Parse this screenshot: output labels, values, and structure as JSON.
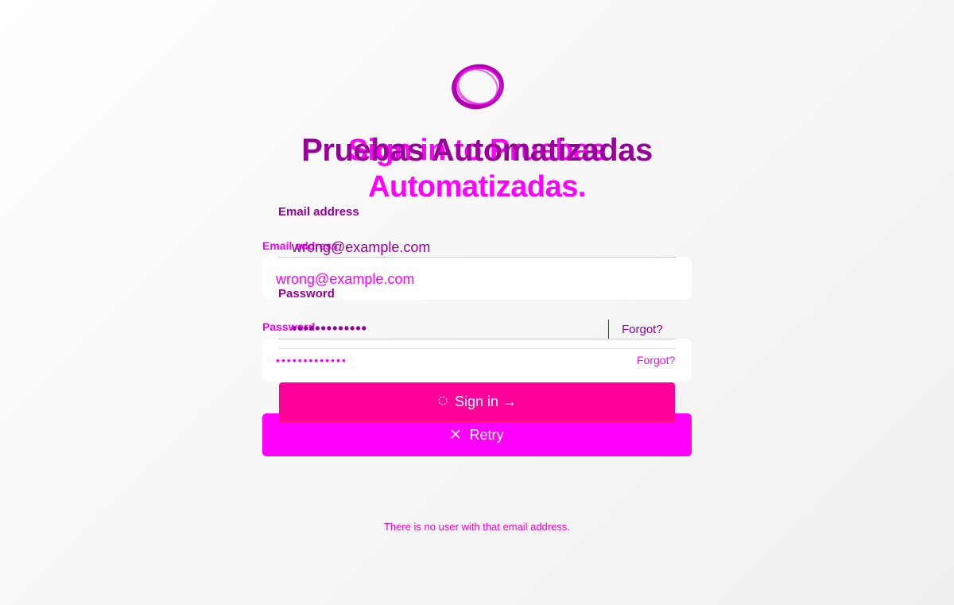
{
  "colors": {
    "primary_magenta": "#ff00ff",
    "primary_purple": "#990099",
    "signin_pink": "#ff0099"
  },
  "logo": {
    "icon": "ring-logo-icon"
  },
  "title_ghost": {
    "line1": "Sign in to Pruebas",
    "line2": "Automatizadas."
  },
  "title_main": "Pruebas Automatizadas",
  "ghost_form": {
    "email_label": "Email address",
    "email_value": "wrong@example.com",
    "password_label": "Password",
    "password_value": "•••••••••••••",
    "forgot_label": "Forgot?",
    "retry_label": "Retry",
    "retry_icon": "close-x-icon"
  },
  "main_form": {
    "email_label": "Email address",
    "email_value": "wrong@example.com",
    "password_label": "Password",
    "password_value": "•••••••••••••",
    "forgot_label": "Forgot?",
    "signin_label": "Sign in →",
    "signin_icon": "spinner-icon"
  },
  "error_message": "There is no user with that email address."
}
